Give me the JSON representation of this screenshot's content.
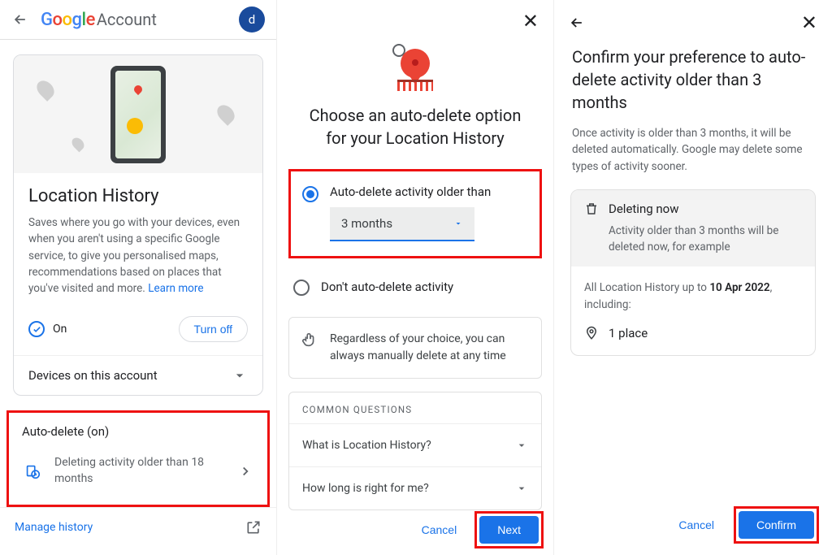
{
  "panel1": {
    "header": {
      "brand": "Google",
      "account": "Account",
      "avatar": "d"
    },
    "card": {
      "title": "Location History",
      "desc": "Saves where you go with your devices, even when you aren't using a specific Google service, to give you personalised maps, recommendations based on places that you've visited and more. ",
      "learn": "Learn more",
      "status": "On",
      "turn_off": "Turn off",
      "devices": "Devices on this account",
      "autodel_title": "Auto-delete (on)",
      "autodel_text": "Deleting activity older than 18 months",
      "manage": "Manage history"
    }
  },
  "panel2": {
    "title": "Choose an auto-delete option for your Location History",
    "opt1": "Auto-delete activity older than",
    "dropdown": "3 months",
    "opt2": "Don't auto-delete activity",
    "note": "Regardless of your choice, you can always manually delete at any time",
    "faq_hdr": "COMMON QUESTIONS",
    "faq1": "What is Location History?",
    "faq2": "How long is right for me?",
    "cancel": "Cancel",
    "next": "Next"
  },
  "panel3": {
    "title": "Confirm your preference to auto-delete activity older than 3 months",
    "desc": "Once activity is older than 3 months, it will be deleted automatically. Google may delete some types of activity sooner.",
    "delnow": "Deleting now",
    "delnow_sub": "Activity older than 3 months will be deleted now, for example",
    "info_pre": "All Location History up to ",
    "info_date": "10 Apr 2022",
    "info_post": ", including:",
    "place": "1 place",
    "cancel": "Cancel",
    "confirm": "Confirm"
  }
}
